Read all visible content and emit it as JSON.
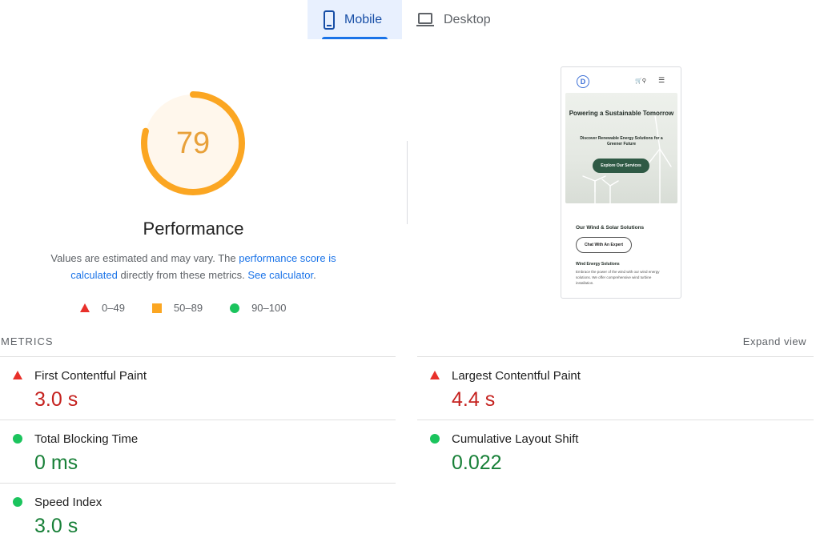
{
  "tabs": [
    {
      "label": "Mobile",
      "icon": "smartphone-icon",
      "active": true
    },
    {
      "label": "Desktop",
      "icon": "laptop-icon",
      "active": false
    }
  ],
  "score": {
    "value": "79",
    "fraction": 0.79,
    "color": "#fba622",
    "title": "Performance"
  },
  "description": {
    "prefix": "Values are estimated and may vary. The ",
    "link1": "performance score is calculated",
    "middle": " directly from these metrics. ",
    "link2": "See calculator",
    "suffix": "."
  },
  "legend": [
    {
      "range": "0–49",
      "shape": "triangle",
      "color": "#e8302a"
    },
    {
      "range": "50–89",
      "shape": "square",
      "color": "#fba622"
    },
    {
      "range": "90–100",
      "shape": "circle",
      "color": "#1bc45d"
    }
  ],
  "preview": {
    "logo_letter": "D",
    "hero_title": "Powering a Sustainable Tomorrow",
    "hero_subtitle": "Discover Renewable Energy Solutions for a Greener Future",
    "hero_button": "Explore Our Services",
    "section_title": "Our Wind & Solar Solutions",
    "section_button": "Chat With An Expert",
    "sub_title": "Wind Energy Solutions",
    "sub_desc": "Embrace the power of the wind with our wind energy solutions. We offer comprehensive wind turbine installation."
  },
  "metrics_header": {
    "label": "METRICS",
    "expand": "Expand view"
  },
  "metrics": [
    {
      "name": "First Contentful Paint",
      "value": "3.0 s",
      "status": "bad"
    },
    {
      "name": "Largest Contentful Paint",
      "value": "4.4 s",
      "status": "bad"
    },
    {
      "name": "Total Blocking Time",
      "value": "0 ms",
      "status": "good"
    },
    {
      "name": "Cumulative Layout Shift",
      "value": "0.022",
      "status": "good"
    },
    {
      "name": "Speed Index",
      "value": "3.0 s",
      "status": "good"
    }
  ]
}
